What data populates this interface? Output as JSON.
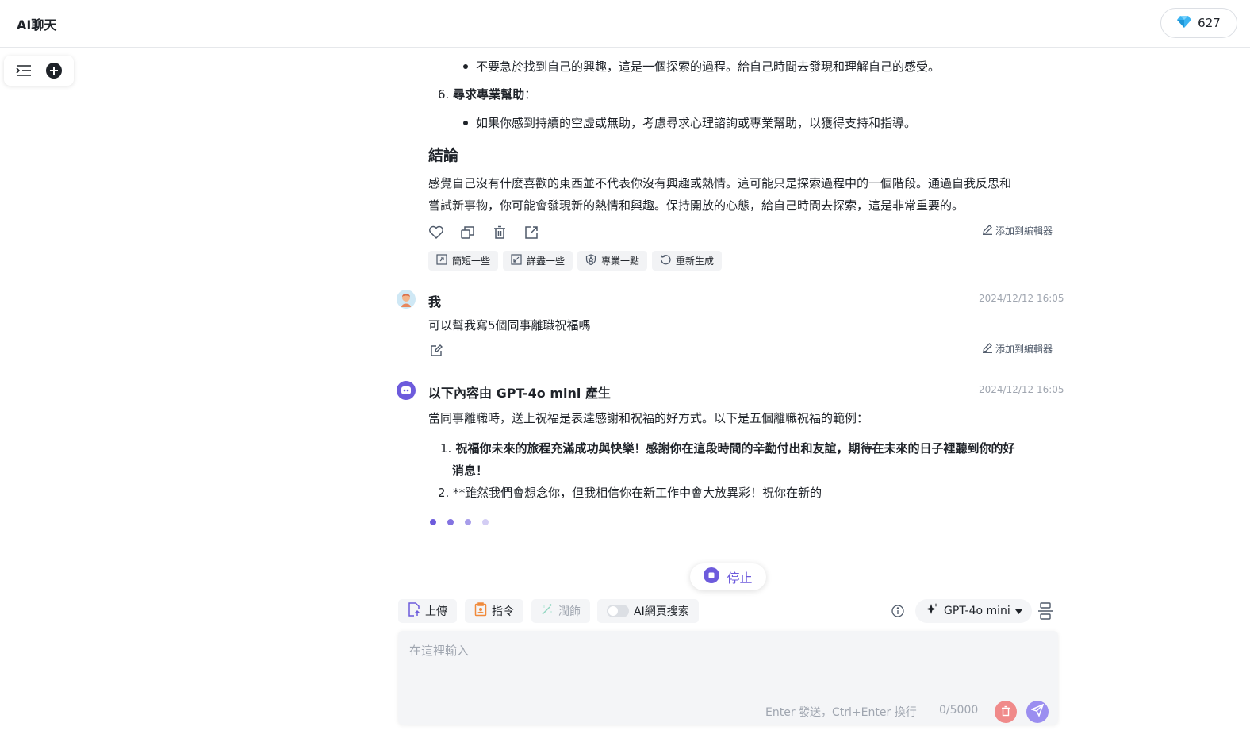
{
  "header": {
    "app_title": "AI聊天",
    "credits": "627"
  },
  "sidebar": {
    "toggle_icon": "list-indent-icon",
    "new_chat_icon": "plus-circle-icon"
  },
  "previous_answer": {
    "bullet_1": "不要急於找到自己的興趣，這是一個探索的過程。給自己時間去發現和理解自己的感受。",
    "item_6_number": "6.",
    "item_6_title": "尋求專業幫助",
    "item_6_colon": "：",
    "bullet_2": "如果你感到持續的空虛或無助，考慮尋求心理諮詢或專業幫助，以獲得支持和指導。",
    "conclusion_heading": "結論",
    "conclusion_line_1": "感覺自己沒有什麼喜歡的東西並不代表你沒有興趣或熱情。這可能只是探索過程中的一個階段。通過自我反思和",
    "conclusion_line_2": "嘗試新事物，你可能會發現新的熱情和興趣。保持開放的心態，給自己時間去探索，這是非常重要的。",
    "add_to_editor": "添加到編輯器",
    "chips": [
      "簡短一些",
      "詳盡一些",
      "專業一點",
      "重新生成"
    ]
  },
  "user_message": {
    "name": "我",
    "time": "2024/12/12 16:05",
    "text": "可以幫我寫5個同事離職祝福嗎",
    "add_to_editor": "添加到編輯器"
  },
  "ai_message": {
    "name": "以下內容由 GPT-4o mini 產生",
    "time": "2024/12/12 16:05",
    "intro": "當同事離職時，送上祝福是表達感謝和祝福的好方式。以下是五個離職祝福的範例：",
    "item_1_number": "1.",
    "item_1_line_1": "祝福你未來的旅程充滿成功與快樂！感謝你在這段時間的辛勤付出和友誼，期待在未來的日子裡聽到你的好",
    "item_1_line_2": "消息！",
    "item_2_number": "2.",
    "item_2_text": "**雖然我們會想念你，但我相信你在新工作中會大放異彩！祝你在新的"
  },
  "composer": {
    "stop_label": "停止",
    "upload_label": "上傳",
    "command_label": "指令",
    "polish_label": "潤飾",
    "web_search_label": "AI網頁搜索",
    "model_label": "GPT-4o mini",
    "placeholder": "在這裡輸入",
    "hint": "Enter 發送，Ctrl+Enter 換行",
    "counter": "0/5000"
  },
  "colors": {
    "accent": "#6d5bdc",
    "delete": "#f08a8a",
    "send": "#9b8ef0"
  }
}
